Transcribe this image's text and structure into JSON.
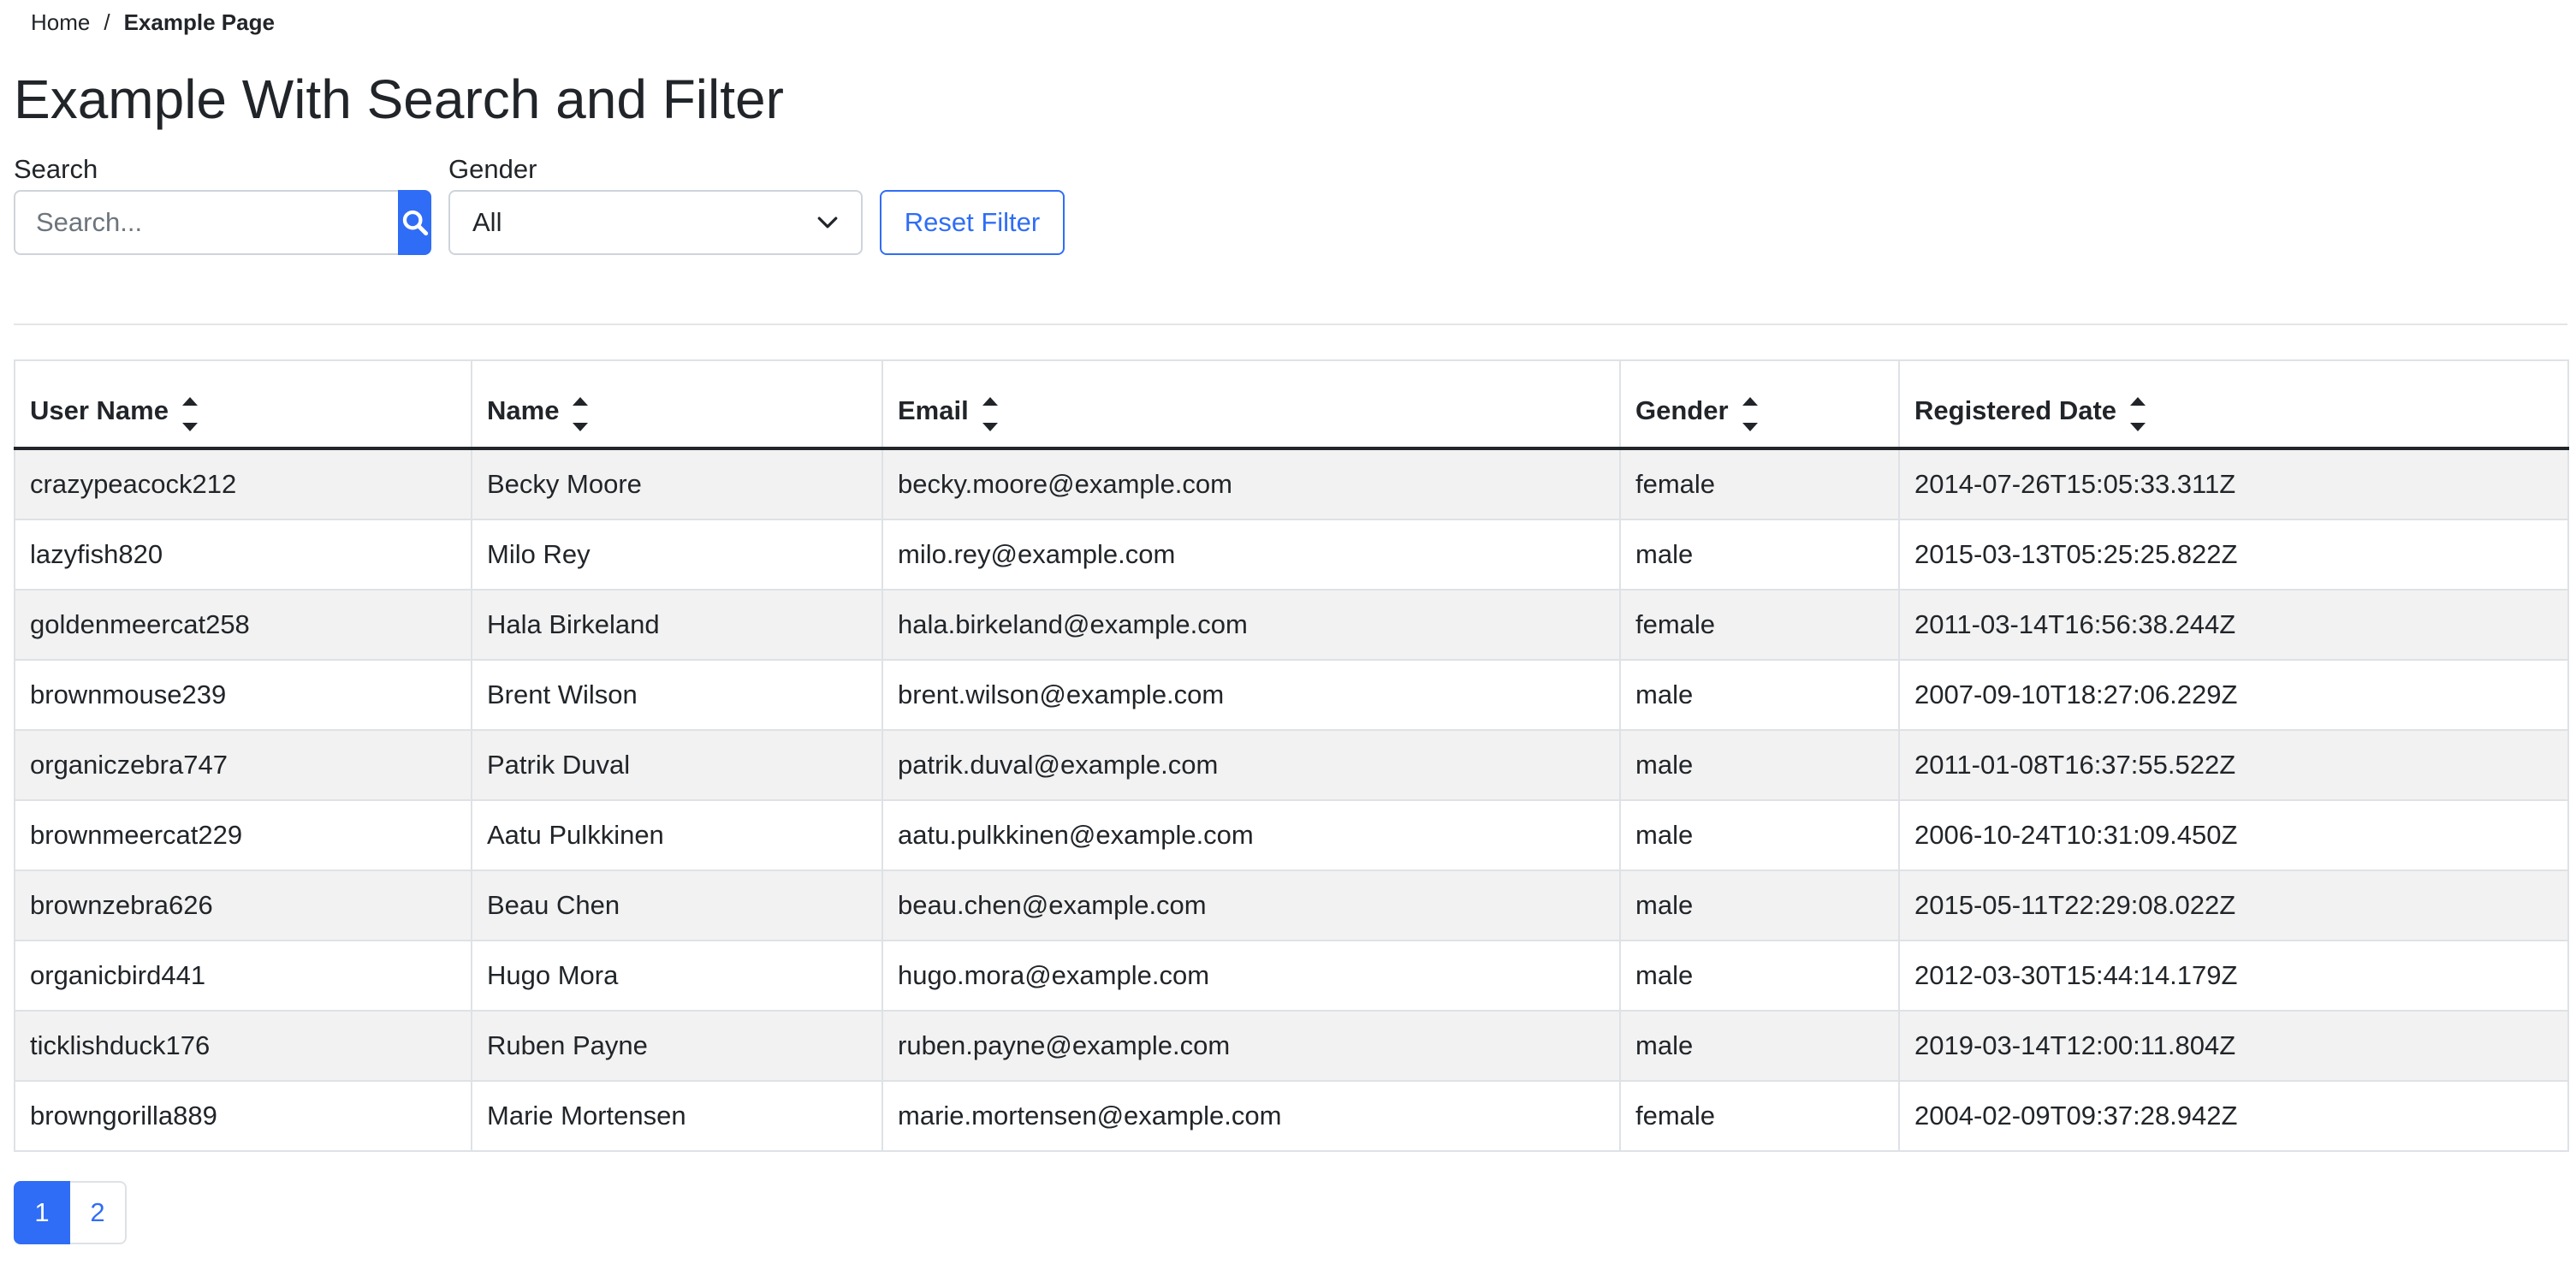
{
  "breadcrumb": {
    "home": "Home",
    "separator": "/",
    "current": "Example Page"
  },
  "page": {
    "title": "Example With Search and Filter"
  },
  "filters": {
    "search_label": "Search",
    "search_placeholder": "Search...",
    "search_value": "",
    "search_button_icon": "search-icon",
    "gender_label": "Gender",
    "gender_selected": "All",
    "reset_label": "Reset Filter"
  },
  "table": {
    "columns": [
      "User Name",
      "Name",
      "Email",
      "Gender",
      "Registered Date"
    ],
    "sort_icon": "sort-icon",
    "rows": [
      [
        "crazypeacock212",
        "Becky Moore",
        "becky.moore@example.com",
        "female",
        "2014-07-26T15:05:33.311Z"
      ],
      [
        "lazyfish820",
        "Milo Rey",
        "milo.rey@example.com",
        "male",
        "2015-03-13T05:25:25.822Z"
      ],
      [
        "goldenmeercat258",
        "Hala Birkeland",
        "hala.birkeland@example.com",
        "female",
        "2011-03-14T16:56:38.244Z"
      ],
      [
        "brownmouse239",
        "Brent Wilson",
        "brent.wilson@example.com",
        "male",
        "2007-09-10T18:27:06.229Z"
      ],
      [
        "organiczebra747",
        "Patrik Duval",
        "patrik.duval@example.com",
        "male",
        "2011-01-08T16:37:55.522Z"
      ],
      [
        "brownmeercat229",
        "Aatu Pulkkinen",
        "aatu.pulkkinen@example.com",
        "male",
        "2006-10-24T10:31:09.450Z"
      ],
      [
        "brownzebra626",
        "Beau Chen",
        "beau.chen@example.com",
        "male",
        "2015-05-11T22:29:08.022Z"
      ],
      [
        "organicbird441",
        "Hugo Mora",
        "hugo.mora@example.com",
        "male",
        "2012-03-30T15:44:14.179Z"
      ],
      [
        "ticklishduck176",
        "Ruben Payne",
        "ruben.payne@example.com",
        "male",
        "2019-03-14T12:00:11.804Z"
      ],
      [
        "browngorilla889",
        "Marie Mortensen",
        "marie.mortensen@example.com",
        "female",
        "2004-02-09T09:37:28.942Z"
      ]
    ]
  },
  "pagination": {
    "pages": [
      "1",
      "2"
    ],
    "active": "1"
  },
  "colors": {
    "primary": "#2f6df6",
    "text": "#212529",
    "stripe": "#f2f2f2",
    "border": "#dee2e6"
  }
}
